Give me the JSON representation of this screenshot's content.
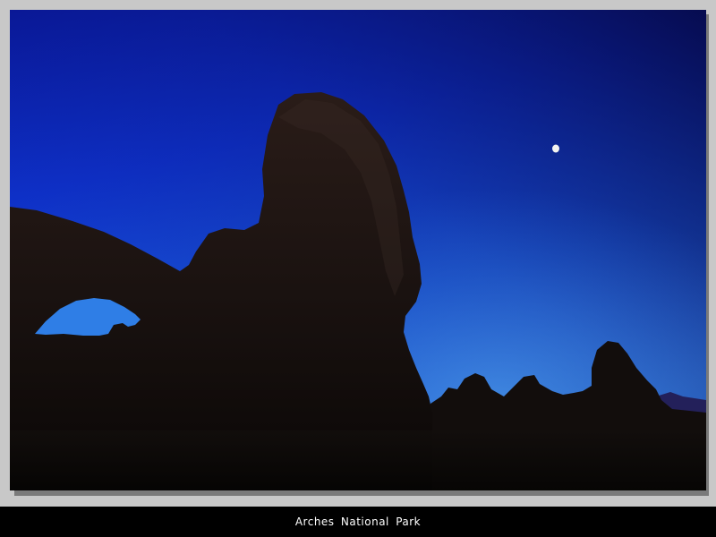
{
  "caption": "Arches National Park",
  "colors": {
    "frame": "#c8c8c8",
    "sky_top": "#0a0a5a",
    "sky_mid": "#1238c8",
    "sky_horizon": "#3a86e8",
    "rock": "#1c1412",
    "moon": "#f4f4f0"
  }
}
